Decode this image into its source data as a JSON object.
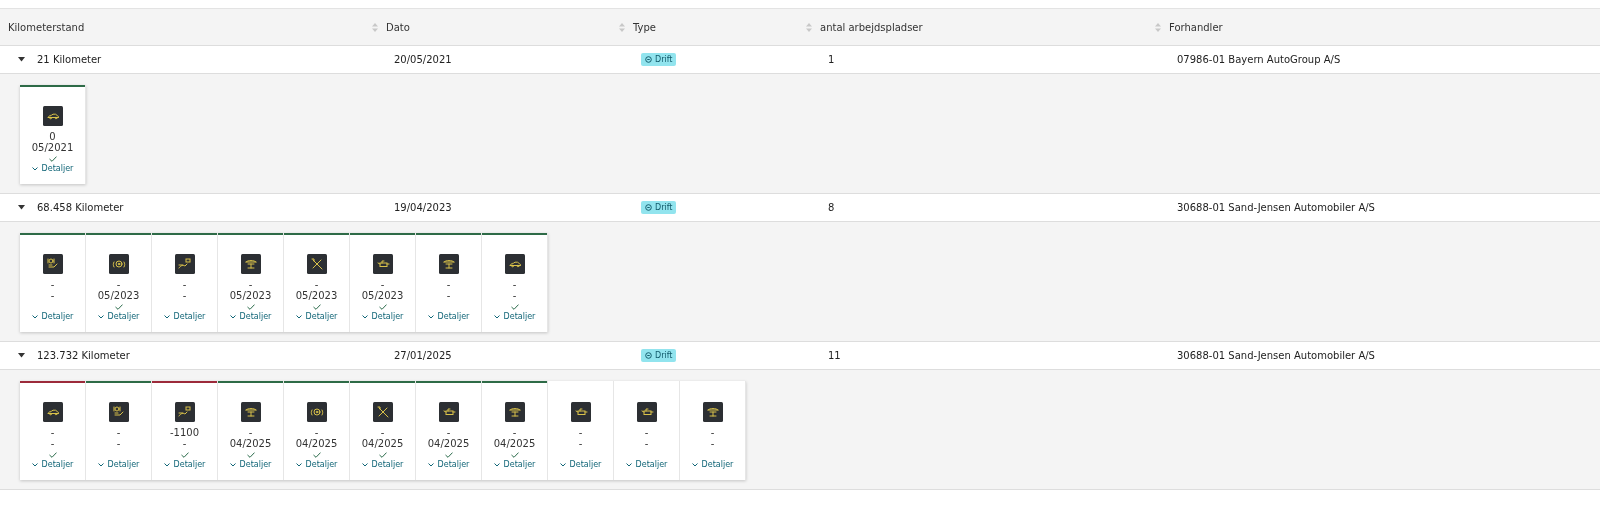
{
  "columns": [
    {
      "label": "Kilometerstand",
      "kind": "plain"
    },
    {
      "label": "Dato",
      "kind": "sort"
    },
    {
      "label": "Type",
      "kind": "sort"
    },
    {
      "label": "antal arbejdspladser",
      "kind": "sort"
    },
    {
      "label": "Forhandler",
      "kind": "sort"
    }
  ],
  "rows": [
    {
      "mileage": "21 Kilometer",
      "date": "20/05/2021",
      "type": "Drift",
      "workplaces": "1",
      "dealer": "07986-01 Bayern AutoGroup A/S",
      "expanded": true,
      "cards": [
        {
          "color": "#2e6b47",
          "kind": "car",
          "line1": "0",
          "line2": "05/2021",
          "done": true,
          "details": "Detaljer"
        }
      ]
    },
    {
      "mileage": "68.458 Kilometer",
      "date": "19/04/2023",
      "type": "Drift",
      "workplaces": "8",
      "dealer": "30688-01 Sand-Jensen Automobiler A/S",
      "expanded": true,
      "cards": [
        {
          "color": "#2e6b47",
          "kind": "disc-hand",
          "line1": "-",
          "line2": "-",
          "done": false,
          "details": "Detaljer"
        },
        {
          "color": "#2e6b47",
          "kind": "brake",
          "line1": "-",
          "line2": "05/2023",
          "done": true,
          "details": "Detaljer"
        },
        {
          "color": "#2e6b47",
          "kind": "hand-disc",
          "line1": "-",
          "line2": "-",
          "done": false,
          "details": "Detaljer"
        },
        {
          "color": "#2e6b47",
          "kind": "lift",
          "line1": "-",
          "line2": "05/2023",
          "done": true,
          "details": "Detaljer"
        },
        {
          "color": "#2e6b47",
          "kind": "tools",
          "line1": "-",
          "line2": "05/2023",
          "done": true,
          "details": "Detaljer"
        },
        {
          "color": "#2e6b47",
          "kind": "oil",
          "line1": "-",
          "line2": "05/2023",
          "done": true,
          "details": "Detaljer"
        },
        {
          "color": "#2e6b47",
          "kind": "lift",
          "line1": "-",
          "line2": "-",
          "done": false,
          "details": "Detaljer"
        },
        {
          "color": "#2e6b47",
          "kind": "car",
          "line1": "-",
          "line2": "-",
          "done": true,
          "details": "Detaljer"
        }
      ]
    },
    {
      "mileage": "123.732 Kilometer",
      "date": "27/01/2025",
      "type": "Drift",
      "workplaces": "11",
      "dealer": "30688-01 Sand-Jensen Automobiler A/S",
      "expanded": true,
      "cards": [
        {
          "color": "#9c2a3a",
          "kind": "car",
          "line1": "-",
          "line2": "-",
          "done": true,
          "details": "Detaljer"
        },
        {
          "color": "#2e6b47",
          "kind": "disc-hand",
          "line1": "-",
          "line2": "-",
          "done": false,
          "details": "Detaljer"
        },
        {
          "color": "#9c2a3a",
          "kind": "hand-disc",
          "line1": "-1100",
          "line2": "-",
          "done": true,
          "details": "Detaljer"
        },
        {
          "color": "#2e6b47",
          "kind": "lift",
          "line1": "-",
          "line2": "04/2025",
          "done": true,
          "details": "Detaljer"
        },
        {
          "color": "#2e6b47",
          "kind": "brake",
          "line1": "-",
          "line2": "04/2025",
          "done": true,
          "details": "Detaljer"
        },
        {
          "color": "#2e6b47",
          "kind": "tools",
          "line1": "-",
          "line2": "04/2025",
          "done": true,
          "details": "Detaljer"
        },
        {
          "color": "#2e6b47",
          "kind": "oil",
          "line1": "-",
          "line2": "04/2025",
          "done": true,
          "details": "Detaljer"
        },
        {
          "color": "#2e6b47",
          "kind": "lift",
          "line1": "-",
          "line2": "04/2025",
          "done": true,
          "details": "Detaljer"
        },
        {
          "kind": "oil",
          "line1": "-",
          "line2": "-",
          "done": false,
          "details": "Detaljer"
        },
        {
          "kind": "oil",
          "line1": "-",
          "line2": "-",
          "done": false,
          "details": "Detaljer"
        },
        {
          "kind": "lift",
          "line1": "-",
          "line2": "-",
          "done": false,
          "details": "Detaljer"
        }
      ]
    }
  ]
}
